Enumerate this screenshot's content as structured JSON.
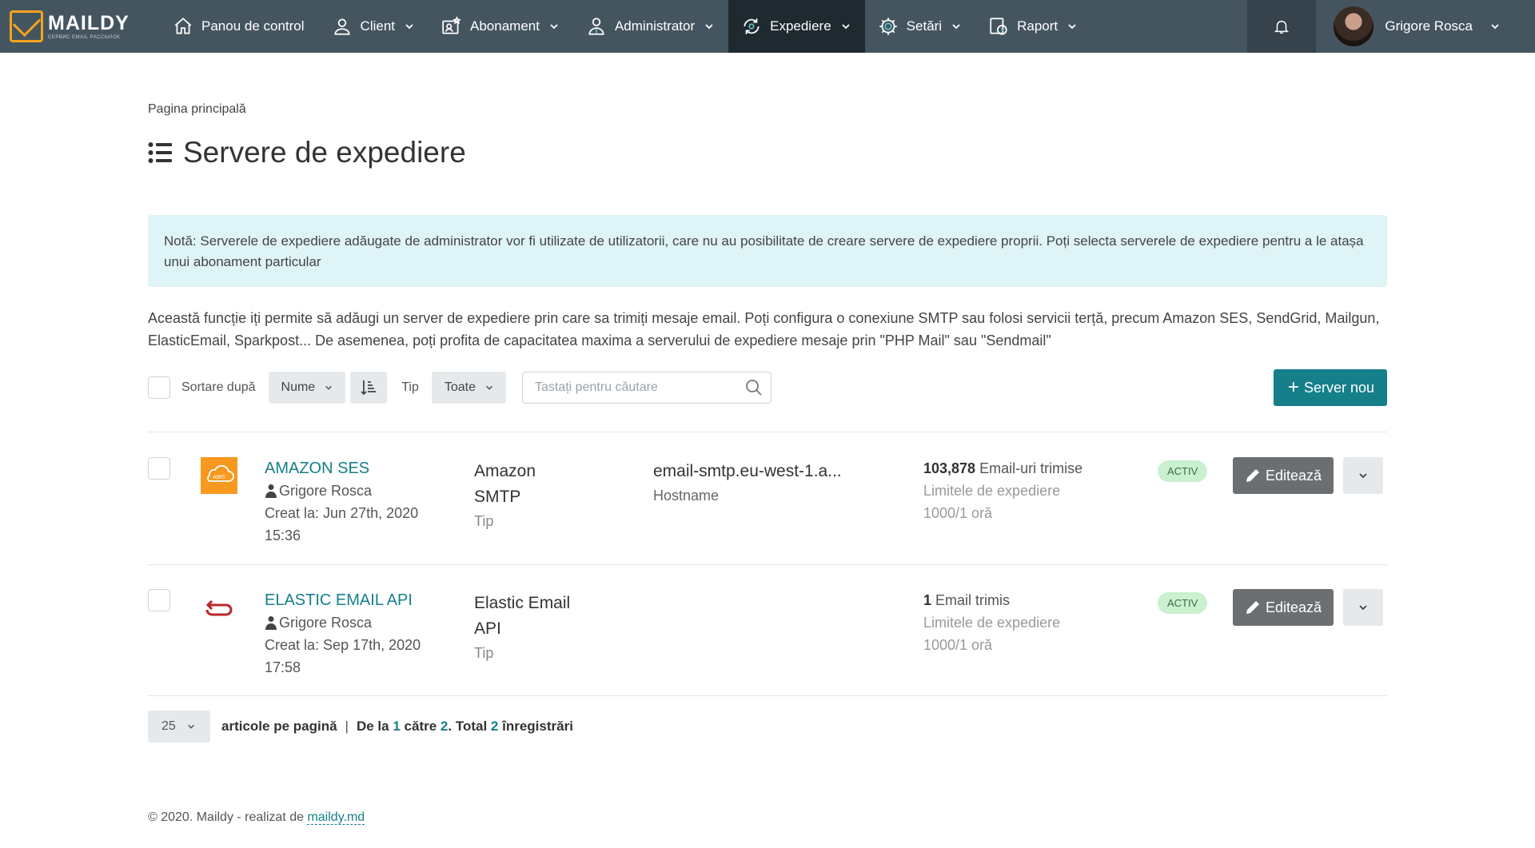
{
  "brand": {
    "name": "MAILDY",
    "tagline": "СЕРВИС EMAIL РАССЫЛОК",
    "accent": "#f2a31b"
  },
  "nav": {
    "items": [
      {
        "label": "Panou de control",
        "icon": "home-icon",
        "has_dropdown": false
      },
      {
        "label": "Client",
        "icon": "user-icon",
        "has_dropdown": true
      },
      {
        "label": "Abonament",
        "icon": "subscription-icon",
        "has_dropdown": true
      },
      {
        "label": "Administrator",
        "icon": "admin-icon",
        "has_dropdown": true
      },
      {
        "label": "Expediere",
        "icon": "send-icon",
        "has_dropdown": true,
        "active": true
      },
      {
        "label": "Setări",
        "icon": "gear-icon",
        "has_dropdown": true
      },
      {
        "label": "Raport",
        "icon": "report-icon",
        "has_dropdown": true
      }
    ],
    "user_name": "Grigore Rosca",
    "colors": {
      "bar": "#455560",
      "active": "#1f2a30"
    }
  },
  "breadcrumb": "Pagina principală",
  "page_title": "Servere de expediere",
  "note": "Notă: Serverele de expediere adăugate de administrator vor fi utilizate de utilizatorii, care nu au posibilitate de creare servere de expediere proprii. Poți selecta serverele de expediere pentru a le atașa unui abonament particular",
  "description": "Această funcție iți permite să adăugi un server de expediere prin care sa trimiți mesaje email. Poți configura o conexiune SMTP sau folosi servicii terță, precum Amazon SES, SendGrid, Mailgun, ElasticEmail, Sparkpost... De asemenea, poți profita de capacitatea maxima a serverului de expediere mesaje prin \"PHP Mail\" sau \"Sendmail\"",
  "toolbar": {
    "sort_label": "Sortare după",
    "sort_value": "Nume",
    "type_label": "Tip",
    "type_value": "Toate",
    "search_placeholder": "Tastați pentru căutare",
    "new_button": "Server nou"
  },
  "servers": [
    {
      "name": "AMAZON SES",
      "icon": "aws-icon",
      "owner": "Grigore Rosca",
      "created_label": "Creat la:",
      "created_date": "Jun 27th, 2020",
      "created_time": "15:36",
      "type_line1": "Amazon",
      "type_line2": "SMTP",
      "type_label": "Tip",
      "hostname": "email-smtp.eu-west-1.a...",
      "hostname_label": "Hostname",
      "sent_count": "103,878",
      "sent_label": "Email-uri trimise",
      "limit_label": "Limitele de expediere",
      "limit_value": "1000/1 oră",
      "status": "ACTIV",
      "edit_label": "Editează"
    },
    {
      "name": "ELASTIC EMAIL API",
      "icon": "elastic-email-icon",
      "owner": "Grigore Rosca",
      "created_label": "Creat la:",
      "created_date": "Sep 17th, 2020",
      "created_time": "17:58",
      "type_line1": "Elastic Email",
      "type_line2": "API",
      "type_label": "Tip",
      "hostname": "",
      "hostname_label": "",
      "sent_count": "1",
      "sent_label": "Email trimis",
      "limit_label": "Limitele de expediere",
      "limit_value": "1000/1 oră",
      "status": "ACTIV",
      "edit_label": "Editează"
    }
  ],
  "pager": {
    "per_page": "25",
    "per_page_label": "articole pe pagină",
    "from_label": "De la",
    "from": "1",
    "to_label": "către",
    "to": "2",
    "total_label": ". Total",
    "total": "2",
    "records_label": "înregistrări"
  },
  "footer": {
    "text": "© 2020. Maildy - realizat de",
    "link": "maildy.md"
  },
  "colors": {
    "primary": "#157f8a",
    "note_bg": "#dff4f7",
    "badge_bg": "#c9f0cf"
  }
}
